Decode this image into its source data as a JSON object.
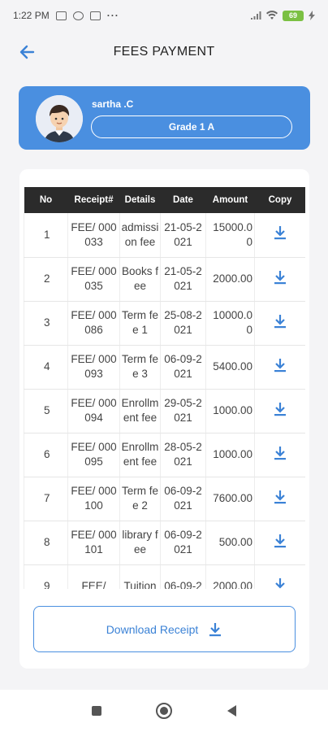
{
  "status": {
    "time": "1:22 PM",
    "dots": "···",
    "battery": "69"
  },
  "header": {
    "title": "FEES PAYMENT"
  },
  "profile": {
    "name": "sartha .C",
    "grade": "Grade 1 A"
  },
  "table": {
    "headers": [
      "No",
      "Receipt#",
      "Details",
      "Date",
      "Amount",
      "Copy"
    ],
    "rows": [
      {
        "no": "1",
        "receipt": "FEE/ 000033",
        "details": "admissi on fee",
        "date": "21-05-2 021",
        "amount": "15000.0 0"
      },
      {
        "no": "2",
        "receipt": "FEE/ 000035",
        "details": "Books fee",
        "date": "21-05-2 021",
        "amount": "2000.00"
      },
      {
        "no": "3",
        "receipt": "FEE/ 000086",
        "details": "Term fee 1",
        "date": "25-08-2 021",
        "amount": "10000.0 0"
      },
      {
        "no": "4",
        "receipt": "FEE/ 000093",
        "details": "Term fee 3",
        "date": "06-09-2 021",
        "amount": "5400.00"
      },
      {
        "no": "5",
        "receipt": "FEE/ 000094",
        "details": "Enrollm ent fee",
        "date": "29-05-2 021",
        "amount": "1000.00"
      },
      {
        "no": "6",
        "receipt": "FEE/ 000095",
        "details": "Enrollm ent fee",
        "date": "28-05-2 021",
        "amount": "1000.00"
      },
      {
        "no": "7",
        "receipt": "FEE/ 000100",
        "details": "Term fee 2",
        "date": "06-09-2 021",
        "amount": "7600.00"
      },
      {
        "no": "8",
        "receipt": "FEE/ 000101",
        "details": "library fee",
        "date": "06-09-2 021",
        "amount": "500.00"
      },
      {
        "no": "9",
        "receipt": "FEE/",
        "details": "Tuition",
        "date": "06-09-2",
        "amount": "2000.00"
      }
    ]
  },
  "actions": {
    "download_receipt": "Download Receipt"
  },
  "colors": {
    "accent": "#4a8fe0",
    "header_bg": "#2b2b2b"
  }
}
